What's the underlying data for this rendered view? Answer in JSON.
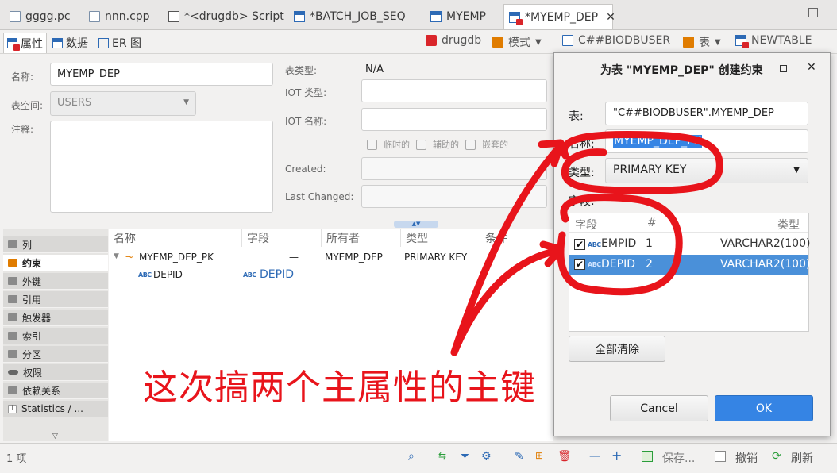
{
  "tabs": [
    {
      "label": "gggg.pc",
      "icon": "file-icon"
    },
    {
      "label": "nnn.cpp",
      "icon": "file-icon"
    },
    {
      "label": "*<drugdb> Script",
      "icon": "script-icon"
    },
    {
      "label": "*BATCH_JOB_SEQ",
      "icon": "table-icon"
    },
    {
      "label": "MYEMP",
      "icon": "table-icon"
    },
    {
      "label": "*MYEMP_DEP",
      "icon": "table-icon"
    }
  ],
  "subtabs": {
    "properties": "属性",
    "data": "数据",
    "er": "ER 图"
  },
  "breadcrumb": {
    "connection": "drugdb",
    "schema_label": "模式",
    "schema": "C##BIODBUSER",
    "table_label": "表",
    "table": "NEWTABLE"
  },
  "form": {
    "name_label": "名称:",
    "name_value": "MYEMP_DEP",
    "tablespace_label": "表空间:",
    "tablespace_value": "USERS",
    "comment_label": "注释:",
    "table_type_label": "表类型:",
    "table_type_value": "N/A",
    "iot_type_label": "IOT 类型:",
    "iot_name_label": "IOT 名称:",
    "temporary_label": "临时的",
    "secondary_label": "辅助的",
    "nested_label": "嵌套的",
    "created_label": "Created:",
    "last_changed_label": "Last Changed:"
  },
  "nav": [
    {
      "label": "列",
      "icon": "folder-icon"
    },
    {
      "label": "约束",
      "icon": "key-folder-icon"
    },
    {
      "label": "外键",
      "icon": "folder-icon"
    },
    {
      "label": "引用",
      "icon": "folder-icon"
    },
    {
      "label": "触发器",
      "icon": "folder-icon"
    },
    {
      "label": "索引",
      "icon": "folder-icon"
    },
    {
      "label": "分区",
      "icon": "folder-icon"
    },
    {
      "label": "权限",
      "icon": "key-icon"
    },
    {
      "label": "依赖关系",
      "icon": "folder-icon"
    },
    {
      "label": "Statistics / ...",
      "icon": "info-icon"
    }
  ],
  "constraints": {
    "headers": [
      "名称",
      "字段",
      "所有者",
      "类型",
      "条件"
    ],
    "row1": {
      "name": "MYEMP_DEP_PK",
      "field": "—",
      "owner": "MYEMP_DEP",
      "type": "PRIMARY KEY"
    },
    "row2": {
      "name": "DEPID",
      "field": "DEPID",
      "owner": "—",
      "type": "—"
    }
  },
  "status": {
    "count": "1 项",
    "save": "保存...",
    "cancel": "撤销",
    "refresh": "刷新"
  },
  "dialog": {
    "title": "为表 \"MYEMP_DEP\" 创建约束",
    "table_label": "表:",
    "table_value": "\"C##BIODBUSER\".MYEMP_DEP",
    "name_label": "名称:",
    "name_value": "MYEMP_DEP_PK",
    "type_label": "类型:",
    "type_value": "PRIMARY KEY",
    "fields_label": "字段:",
    "columns": [
      "字段",
      "#",
      "类型"
    ],
    "rows": [
      {
        "name": "EMPID",
        "num": "1",
        "type": "VARCHAR2(100)"
      },
      {
        "name": "DEPID",
        "num": "2",
        "type": "VARCHAR2(100)"
      }
    ],
    "clear_all": "全部清除",
    "cancel": "Cancel",
    "ok": "OK"
  },
  "annotation": "这次搞两个主属性的主键",
  "colors": {
    "annotation_red": "#e8141b",
    "accent_blue": "#3584e4",
    "selection_blue": "#4a90d9"
  }
}
